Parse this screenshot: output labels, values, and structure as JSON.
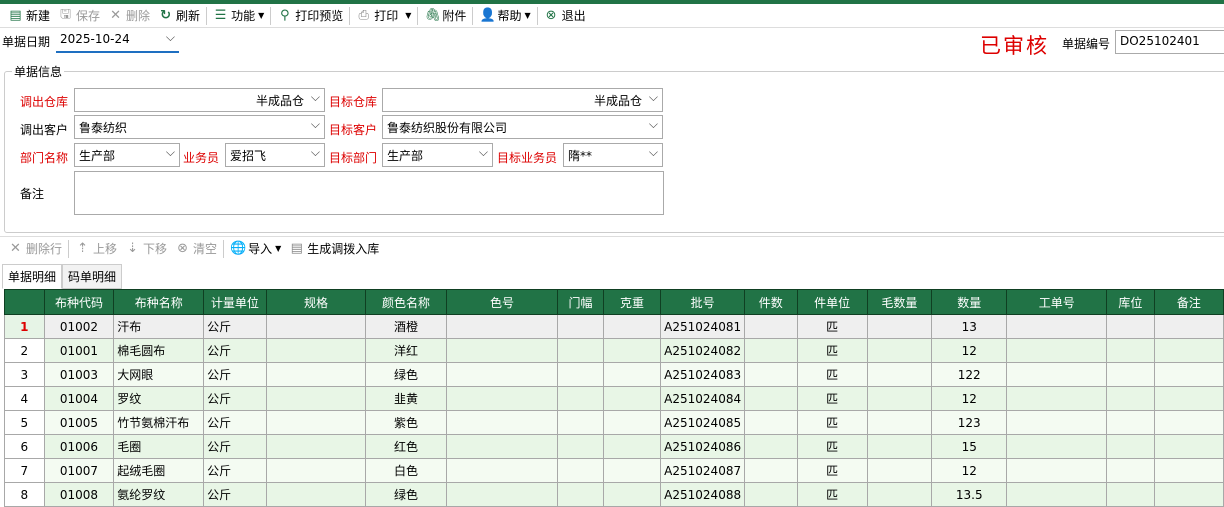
{
  "toolbar": {
    "new": "新建",
    "save": "保存",
    "delete": "删除",
    "refresh": "刷新",
    "function": "功能",
    "print_preview": "打印预览",
    "print": "打印",
    "attachment": "附件",
    "help": "帮助",
    "exit": "退出"
  },
  "header": {
    "date_label": "单据日期",
    "date_value": "2025-10-24",
    "status": "已审核",
    "doc_no_label": "单据编号",
    "doc_no_value": "DO25102401"
  },
  "form": {
    "group_title": "单据信息",
    "out_warehouse_label": "调出仓库",
    "out_warehouse": "半成品仓",
    "target_warehouse_label": "目标仓库",
    "target_warehouse": "半成品仓",
    "out_customer_label": "调出客户",
    "out_customer": "鲁泰纺织",
    "target_customer_label": "目标客户",
    "target_customer": "鲁泰纺织股份有限公司",
    "dept_label": "部门名称",
    "dept": "生产部",
    "salesman_label": "业务员",
    "salesman": "爱招飞",
    "target_dept_label": "目标部门",
    "target_dept": "生产部",
    "target_salesman_label": "目标业务员",
    "target_salesman": "隋**",
    "remark_label": "备注",
    "remark": ""
  },
  "toolbar2": {
    "delete_row": "删除行",
    "move_up": "上移",
    "move_down": "下移",
    "clear": "清空",
    "import": "导入",
    "generate": "生成调拨入库"
  },
  "tabs": [
    "单据明细",
    "码单明细"
  ],
  "table": {
    "columns": [
      "",
      "布种代码",
      "布种名称",
      "计量单位",
      "规格",
      "颜色名称",
      "色号",
      "门幅",
      "克重",
      "批号",
      "件数",
      "件单位",
      "毛数量",
      "数量",
      "工单号",
      "库位",
      "备注"
    ],
    "rows": [
      [
        "1",
        "01002",
        "汗布",
        "公斤",
        "",
        "酒橙",
        "",
        "",
        "",
        "A251024081",
        "",
        "匹",
        "",
        "13",
        "",
        "",
        ""
      ],
      [
        "2",
        "01001",
        "棉毛圆布",
        "公斤",
        "",
        "洋红",
        "",
        "",
        "",
        "A251024082",
        "",
        "匹",
        "",
        "12",
        "",
        "",
        ""
      ],
      [
        "3",
        "01003",
        "大网眼",
        "公斤",
        "",
        "绿色",
        "",
        "",
        "",
        "A251024083",
        "",
        "匹",
        "",
        "122",
        "",
        "",
        ""
      ],
      [
        "4",
        "01004",
        "罗纹",
        "公斤",
        "",
        "韭黄",
        "",
        "",
        "",
        "A251024084",
        "",
        "匹",
        "",
        "12",
        "",
        "",
        ""
      ],
      [
        "5",
        "01005",
        "竹节氨棉汗布",
        "公斤",
        "",
        "紫色",
        "",
        "",
        "",
        "A251024085",
        "",
        "匹",
        "",
        "123",
        "",
        "",
        ""
      ],
      [
        "6",
        "01006",
        "毛圈",
        "公斤",
        "",
        "红色",
        "",
        "",
        "",
        "A251024086",
        "",
        "匹",
        "",
        "15",
        "",
        "",
        ""
      ],
      [
        "7",
        "01007",
        "起绒毛圈",
        "公斤",
        "",
        "白色",
        "",
        "",
        "",
        "A251024087",
        "",
        "匹",
        "",
        "12",
        "",
        "",
        ""
      ],
      [
        "8",
        "01008",
        "氨纶罗纹",
        "公斤",
        "",
        "绿色",
        "",
        "",
        "",
        "A251024088",
        "",
        "匹",
        "",
        "13.5",
        "",
        "",
        ""
      ]
    ]
  }
}
